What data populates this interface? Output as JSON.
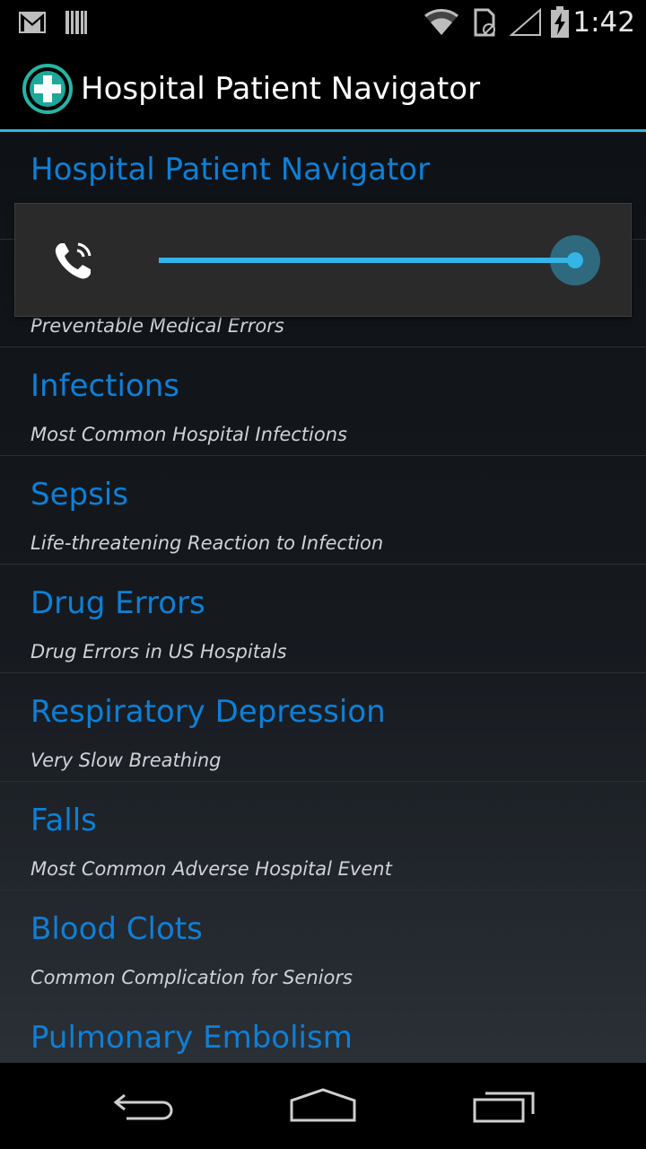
{
  "status_bar": {
    "time": "1:42",
    "icons": [
      "gmail-icon",
      "barcode-icon",
      "wifi-icon",
      "sim-icon",
      "signal-icon",
      "battery-charging-icon"
    ]
  },
  "action_bar": {
    "title": "Hospital Patient Navigator",
    "icon": "medical-cross-icon"
  },
  "list": {
    "items": [
      {
        "title": "Hospital Patient Navigator",
        "subtitle": ""
      },
      {
        "title": "",
        "subtitle": "Preventable Medical Errors"
      },
      {
        "title": "Infections",
        "subtitle": "Most Common Hospital Infections"
      },
      {
        "title": "Sepsis",
        "subtitle": "Life-threatening Reaction to Infection"
      },
      {
        "title": "Drug Errors",
        "subtitle": "Drug Errors in US Hospitals"
      },
      {
        "title": "Respiratory Depression",
        "subtitle": "Very Slow Breathing"
      },
      {
        "title": "Falls",
        "subtitle": "Most Common Adverse Hospital Event"
      },
      {
        "title": "Blood Clots",
        "subtitle": "Common Complication for Seniors"
      },
      {
        "title": "Pulmonary Embolism",
        "subtitle": ""
      }
    ]
  },
  "volume_overlay": {
    "icon": "phone-call-icon",
    "level_fraction": 1.0,
    "accent_color": "#33b5e5"
  },
  "nav_bar": {
    "buttons": [
      "back-icon",
      "home-icon",
      "recents-icon"
    ]
  }
}
